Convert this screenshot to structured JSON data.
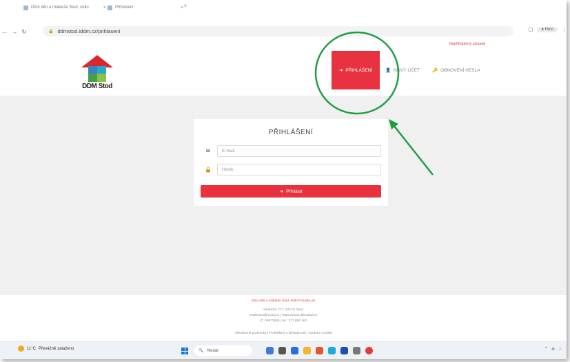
{
  "browser": {
    "tabs": [
      {
        "label": "Dům dětí a mládeže Stod, sídlo"
      },
      {
        "label": "Přihlášení"
      }
    ],
    "new_tab": "+",
    "url": "ddmstod.iddm.cz/prihlaseni",
    "profile_label": "Host"
  },
  "site": {
    "top_link": "Nepřihlášený uživatel",
    "logo_text": "DDM Stod",
    "nav": {
      "login": "PŘIHLÁŠENÍ",
      "register": "NOVÝ ÚČET",
      "reset": "OBNOVENÍ HESLA"
    },
    "login_card": {
      "title": "PŘIHLÁŠENÍ",
      "email_placeholder": "E-mail",
      "password_placeholder": "Heslo",
      "submit_label": "Přihlásit"
    },
    "footer": {
      "org": "Dům dětí a mládeže Stod, sídlo Pozorky ph",
      "address": "Nádražní 777, 333 01 Stod",
      "contact": "msdmstod@volny.cz | https://www.ddmstod.eu",
      "ids": "IČ: 00973826 | tel.: 377 891 263",
      "links": "Všeobecné podmínky | Prohlášení o přístupnosti | Soubory Cookie"
    }
  },
  "taskbar": {
    "temperature": "11°C",
    "weather_text": "Převážně zataženo",
    "search_label": "Hledat"
  },
  "colors": {
    "accent": "#e8323f",
    "annotation": "#1e9e3e"
  }
}
